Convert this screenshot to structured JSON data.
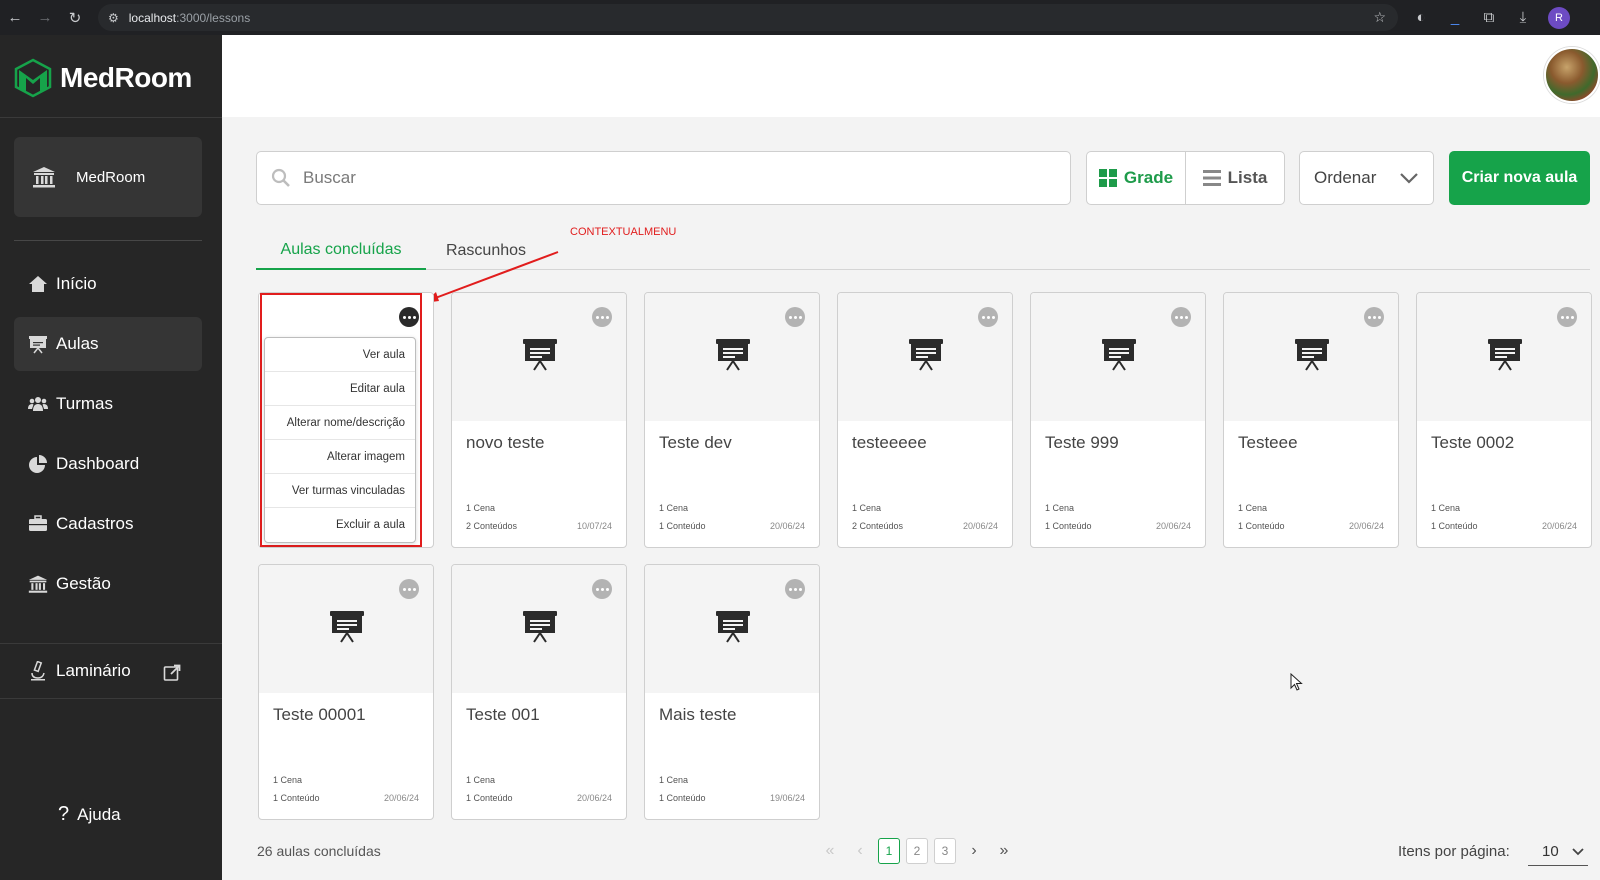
{
  "browser": {
    "url_host": "localhost",
    "url_rest": ":3000/lessons",
    "profile_initial": "R"
  },
  "sidebar": {
    "brand": "MedRoom",
    "org": "MedRoom",
    "items": [
      {
        "label": "Início",
        "icon": "home-icon"
      },
      {
        "label": "Aulas",
        "icon": "presentation-icon"
      },
      {
        "label": "Turmas",
        "icon": "users-icon"
      },
      {
        "label": "Dashboard",
        "icon": "pie-chart-icon"
      },
      {
        "label": "Cadastros",
        "icon": "briefcase-icon"
      },
      {
        "label": "Gestão",
        "icon": "bank-icon"
      }
    ],
    "external": "Laminário",
    "help": "Ajuda"
  },
  "toolbar": {
    "search_placeholder": "Buscar",
    "grade_label": "Grade",
    "lista_label": "Lista",
    "order_label": "Ordenar",
    "create_label": "Criar nova aula"
  },
  "tabs": [
    "Aulas concluídas",
    "Rascunhos"
  ],
  "annotation": "CONTEXTUALMENU",
  "context_menu": [
    "Ver aula",
    "Editar aula",
    "Alterar nome/descrição",
    "Alterar imagem",
    "Ver turmas vinculadas",
    "Excluir a aula"
  ],
  "cards": [
    {
      "title": "",
      "scenes": "",
      "contents": "",
      "date": ""
    },
    {
      "title": "novo teste",
      "scenes": "1 Cena",
      "contents": "2 Conteúdos",
      "date": "10/07/24"
    },
    {
      "title": "Teste dev",
      "scenes": "1 Cena",
      "contents": "1 Conteúdo",
      "date": "20/06/24"
    },
    {
      "title": "testeeeee",
      "scenes": "1 Cena",
      "contents": "2 Conteúdos",
      "date": "20/06/24"
    },
    {
      "title": "Teste 999",
      "scenes": "1 Cena",
      "contents": "1 Conteúdo",
      "date": "20/06/24"
    },
    {
      "title": "Testeee",
      "scenes": "1 Cena",
      "contents": "1 Conteúdo",
      "date": "20/06/24"
    },
    {
      "title": "Teste 0002",
      "scenes": "1 Cena",
      "contents": "1 Conteúdo",
      "date": "20/06/24"
    },
    {
      "title": "Teste 00001",
      "scenes": "1 Cena",
      "contents": "1 Conteúdo",
      "date": "20/06/24"
    },
    {
      "title": "Teste 001",
      "scenes": "1 Cena",
      "contents": "1 Conteúdo",
      "date": "20/06/24"
    },
    {
      "title": "Mais teste",
      "scenes": "1 Cena",
      "contents": "1 Conteúdo",
      "date": "19/06/24"
    }
  ],
  "footer": {
    "count": "26 aulas concluídas",
    "pages": [
      "1",
      "2",
      "3"
    ],
    "current_page": "1",
    "per_page_label": "Itens por página:",
    "per_page_value": "10"
  },
  "colors": {
    "accent": "#16a34a",
    "sidebar_bg": "#262626",
    "annotation": "#e11d1d"
  }
}
